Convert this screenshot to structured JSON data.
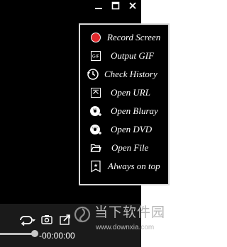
{
  "menu": {
    "items": [
      {
        "label": "Record Screen",
        "icon": "record-icon"
      },
      {
        "label": "Output GIF",
        "icon": "gif-icon"
      },
      {
        "label": "Check History",
        "icon": "history-icon"
      },
      {
        "label": "Open URL",
        "icon": "url-icon"
      },
      {
        "label": "Open Bluray",
        "icon": "bluray-icon"
      },
      {
        "label": "Open DVD",
        "icon": "dvd-icon"
      },
      {
        "label": "Open File",
        "icon": "folder-icon"
      },
      {
        "label": "Always on top",
        "icon": "pin-icon"
      }
    ]
  },
  "player": {
    "time": "-00:00:00",
    "seek_progress": 0.24
  },
  "watermark": {
    "text": "当下软件园",
    "url": "www.downxia.com"
  },
  "colors": {
    "record_dot": "#e0282c",
    "menu_border": "#d9d9d9",
    "background": "#000000"
  }
}
